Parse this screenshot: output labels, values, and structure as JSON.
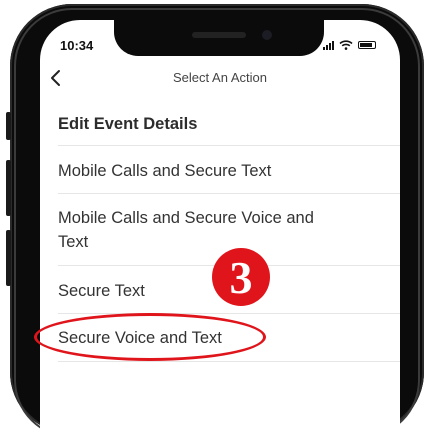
{
  "status_bar": {
    "time": "10:34"
  },
  "nav": {
    "title": "Select An Action",
    "back_icon": "chevron-left-icon"
  },
  "actions": [
    "Edit Event Details",
    "Mobile Calls and Secure Text",
    "Mobile Calls and Secure Voice and Text",
    "Secure Text",
    "Secure Voice and Text"
  ],
  "annotation": {
    "step_number": "3",
    "color": "#e0151c"
  }
}
